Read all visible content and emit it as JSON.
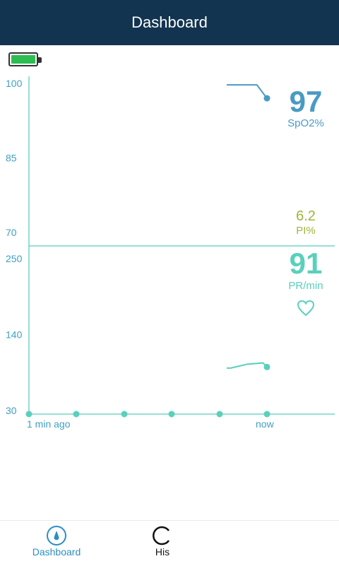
{
  "header": {
    "title": "Dashboard"
  },
  "battery": {
    "level": 1.0,
    "color": "#2dbd52"
  },
  "colors": {
    "spo2": "#4a9ac6",
    "pi": "#a0b43a",
    "pr": "#5ad0bc",
    "axis": "#72d6c8",
    "header": "#123450",
    "nav_active": "#2a8fc4"
  },
  "chart_data": [
    {
      "type": "line",
      "name": "SpO2",
      "ylim": [
        70,
        100
      ],
      "y_ticks": [
        "100",
        "85",
        "70"
      ],
      "x": [
        -0.8,
        -0.2,
        0
      ],
      "values": [
        99.7,
        99.7,
        97
      ]
    },
    {
      "type": "line",
      "name": "PR",
      "ylim": [
        30,
        250
      ],
      "y_ticks": [
        "250",
        "140",
        "30"
      ],
      "x": [
        -1.0,
        -0.9,
        -0.5,
        -0.1,
        0
      ],
      "values": [
        91.5,
        91.5,
        97,
        99,
        93
      ],
      "x_labels": {
        "start": "1 min ago",
        "end": "now"
      }
    }
  ],
  "readouts": {
    "spo2": {
      "value": "97",
      "label": "SpO2%"
    },
    "pi": {
      "value": "6.2",
      "label": "PI%"
    },
    "pr": {
      "value": "91",
      "label": "PR/min"
    }
  },
  "nav": {
    "dashboard": {
      "label": "Dashboard",
      "icon": "gauge-icon"
    },
    "history": {
      "label": "His",
      "icon": "history-icon"
    }
  }
}
